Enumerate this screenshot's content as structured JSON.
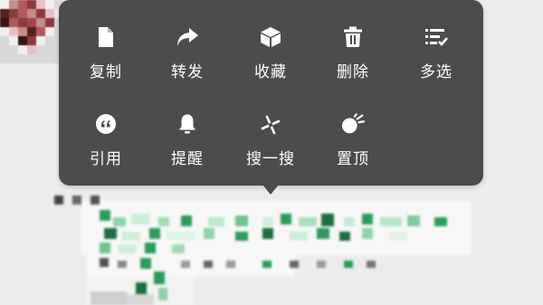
{
  "context_menu": {
    "rows": [
      [
        {
          "label": "复制",
          "icon": "copy-icon"
        },
        {
          "label": "转发",
          "icon": "forward-icon"
        },
        {
          "label": "收藏",
          "icon": "favorite-cube-icon"
        },
        {
          "label": "删除",
          "icon": "trash-icon"
        },
        {
          "label": "多选",
          "icon": "multi-select-icon"
        }
      ],
      [
        {
          "label": "引用",
          "icon": "quote-icon"
        },
        {
          "label": "提醒",
          "icon": "bell-icon"
        },
        {
          "label": "搜一搜",
          "icon": "search-sparkle-icon"
        },
        {
          "label": "置顶",
          "icon": "pin-top-icon"
        }
      ]
    ]
  },
  "colors": {
    "menu_bg": "#4c4c4c",
    "menu_text": "#ffffff",
    "chat_bg": "#ececec",
    "message_green": "#2a9d5c"
  }
}
